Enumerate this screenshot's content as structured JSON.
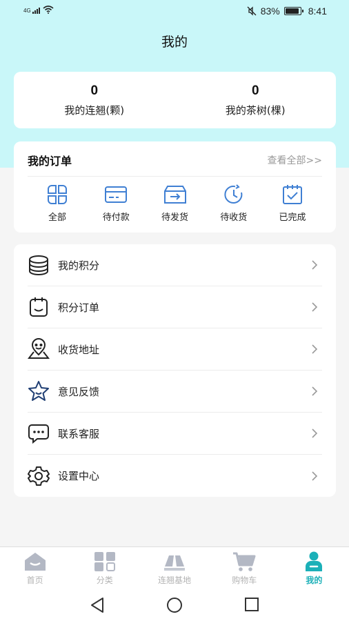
{
  "status_bar": {
    "network": "4G",
    "battery": "83%",
    "battery_level": 0.83,
    "time": "8:41"
  },
  "page_title": "我的",
  "stats": [
    {
      "value": "0",
      "label": "我的连翘(颗)"
    },
    {
      "value": "0",
      "label": "我的茶树(棵)"
    }
  ],
  "orders": {
    "title": "我的订单",
    "view_all": "查看全部>>",
    "items": [
      {
        "label": "全部",
        "icon": "grid-icon"
      },
      {
        "label": "待付款",
        "icon": "card-icon"
      },
      {
        "label": "待发货",
        "icon": "shipping-box-icon"
      },
      {
        "label": "待收货",
        "icon": "clock-icon"
      },
      {
        "label": "已完成",
        "icon": "check-calendar-icon"
      }
    ]
  },
  "menu": [
    {
      "label": "我的积分",
      "icon": "coins-icon"
    },
    {
      "label": "积分订单",
      "icon": "order-icon"
    },
    {
      "label": "收货地址",
      "icon": "location-icon"
    },
    {
      "label": "意见反馈",
      "icon": "star-icon"
    },
    {
      "label": "联系客服",
      "icon": "chat-icon"
    },
    {
      "label": "设置中心",
      "icon": "gear-icon"
    }
  ],
  "tabbar": [
    {
      "label": "首页",
      "icon": "home-icon"
    },
    {
      "label": "分类",
      "icon": "category-icon"
    },
    {
      "label": "连翘基地",
      "icon": "map-icon"
    },
    {
      "label": "购物车",
      "icon": "cart-icon"
    },
    {
      "label": "我的",
      "icon": "user-icon",
      "active": true
    }
  ],
  "colors": {
    "header_bg": "#c9f7f9",
    "accent": "#1bb0b8",
    "icon_blue": "#3f7fd3",
    "inactive": "#b3b3b3"
  }
}
